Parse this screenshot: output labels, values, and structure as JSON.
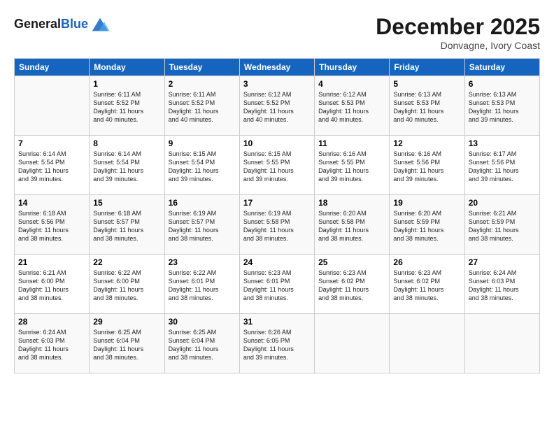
{
  "header": {
    "logo_line1": "General",
    "logo_line2": "Blue",
    "month": "December 2025",
    "location": "Donvagne, Ivory Coast"
  },
  "weekdays": [
    "Sunday",
    "Monday",
    "Tuesday",
    "Wednesday",
    "Thursday",
    "Friday",
    "Saturday"
  ],
  "weeks": [
    [
      {
        "day": "",
        "info": ""
      },
      {
        "day": "1",
        "info": "Sunrise: 6:11 AM\nSunset: 5:52 PM\nDaylight: 11 hours\nand 40 minutes."
      },
      {
        "day": "2",
        "info": "Sunrise: 6:11 AM\nSunset: 5:52 PM\nDaylight: 11 hours\nand 40 minutes."
      },
      {
        "day": "3",
        "info": "Sunrise: 6:12 AM\nSunset: 5:52 PM\nDaylight: 11 hours\nand 40 minutes."
      },
      {
        "day": "4",
        "info": "Sunrise: 6:12 AM\nSunset: 5:53 PM\nDaylight: 11 hours\nand 40 minutes."
      },
      {
        "day": "5",
        "info": "Sunrise: 6:13 AM\nSunset: 5:53 PM\nDaylight: 11 hours\nand 40 minutes."
      },
      {
        "day": "6",
        "info": "Sunrise: 6:13 AM\nSunset: 5:53 PM\nDaylight: 11 hours\nand 39 minutes."
      }
    ],
    [
      {
        "day": "7",
        "info": "Sunrise: 6:14 AM\nSunset: 5:54 PM\nDaylight: 11 hours\nand 39 minutes."
      },
      {
        "day": "8",
        "info": "Sunrise: 6:14 AM\nSunset: 5:54 PM\nDaylight: 11 hours\nand 39 minutes."
      },
      {
        "day": "9",
        "info": "Sunrise: 6:15 AM\nSunset: 5:54 PM\nDaylight: 11 hours\nand 39 minutes."
      },
      {
        "day": "10",
        "info": "Sunrise: 6:15 AM\nSunset: 5:55 PM\nDaylight: 11 hours\nand 39 minutes."
      },
      {
        "day": "11",
        "info": "Sunrise: 6:16 AM\nSunset: 5:55 PM\nDaylight: 11 hours\nand 39 minutes."
      },
      {
        "day": "12",
        "info": "Sunrise: 6:16 AM\nSunset: 5:56 PM\nDaylight: 11 hours\nand 39 minutes."
      },
      {
        "day": "13",
        "info": "Sunrise: 6:17 AM\nSunset: 5:56 PM\nDaylight: 11 hours\nand 39 minutes."
      }
    ],
    [
      {
        "day": "14",
        "info": "Sunrise: 6:18 AM\nSunset: 5:56 PM\nDaylight: 11 hours\nand 38 minutes."
      },
      {
        "day": "15",
        "info": "Sunrise: 6:18 AM\nSunset: 5:57 PM\nDaylight: 11 hours\nand 38 minutes."
      },
      {
        "day": "16",
        "info": "Sunrise: 6:19 AM\nSunset: 5:57 PM\nDaylight: 11 hours\nand 38 minutes."
      },
      {
        "day": "17",
        "info": "Sunrise: 6:19 AM\nSunset: 5:58 PM\nDaylight: 11 hours\nand 38 minutes."
      },
      {
        "day": "18",
        "info": "Sunrise: 6:20 AM\nSunset: 5:58 PM\nDaylight: 11 hours\nand 38 minutes."
      },
      {
        "day": "19",
        "info": "Sunrise: 6:20 AM\nSunset: 5:59 PM\nDaylight: 11 hours\nand 38 minutes."
      },
      {
        "day": "20",
        "info": "Sunrise: 6:21 AM\nSunset: 5:59 PM\nDaylight: 11 hours\nand 38 minutes."
      }
    ],
    [
      {
        "day": "21",
        "info": "Sunrise: 6:21 AM\nSunset: 6:00 PM\nDaylight: 11 hours\nand 38 minutes."
      },
      {
        "day": "22",
        "info": "Sunrise: 6:22 AM\nSunset: 6:00 PM\nDaylight: 11 hours\nand 38 minutes."
      },
      {
        "day": "23",
        "info": "Sunrise: 6:22 AM\nSunset: 6:01 PM\nDaylight: 11 hours\nand 38 minutes."
      },
      {
        "day": "24",
        "info": "Sunrise: 6:23 AM\nSunset: 6:01 PM\nDaylight: 11 hours\nand 38 minutes."
      },
      {
        "day": "25",
        "info": "Sunrise: 6:23 AM\nSunset: 6:02 PM\nDaylight: 11 hours\nand 38 minutes."
      },
      {
        "day": "26",
        "info": "Sunrise: 6:23 AM\nSunset: 6:02 PM\nDaylight: 11 hours\nand 38 minutes."
      },
      {
        "day": "27",
        "info": "Sunrise: 6:24 AM\nSunset: 6:03 PM\nDaylight: 11 hours\nand 38 minutes."
      }
    ],
    [
      {
        "day": "28",
        "info": "Sunrise: 6:24 AM\nSunset: 6:03 PM\nDaylight: 11 hours\nand 38 minutes."
      },
      {
        "day": "29",
        "info": "Sunrise: 6:25 AM\nSunset: 6:04 PM\nDaylight: 11 hours\nand 38 minutes."
      },
      {
        "day": "30",
        "info": "Sunrise: 6:25 AM\nSunset: 6:04 PM\nDaylight: 11 hours\nand 38 minutes."
      },
      {
        "day": "31",
        "info": "Sunrise: 6:26 AM\nSunset: 6:05 PM\nDaylight: 11 hours\nand 39 minutes."
      },
      {
        "day": "",
        "info": ""
      },
      {
        "day": "",
        "info": ""
      },
      {
        "day": "",
        "info": ""
      }
    ]
  ]
}
